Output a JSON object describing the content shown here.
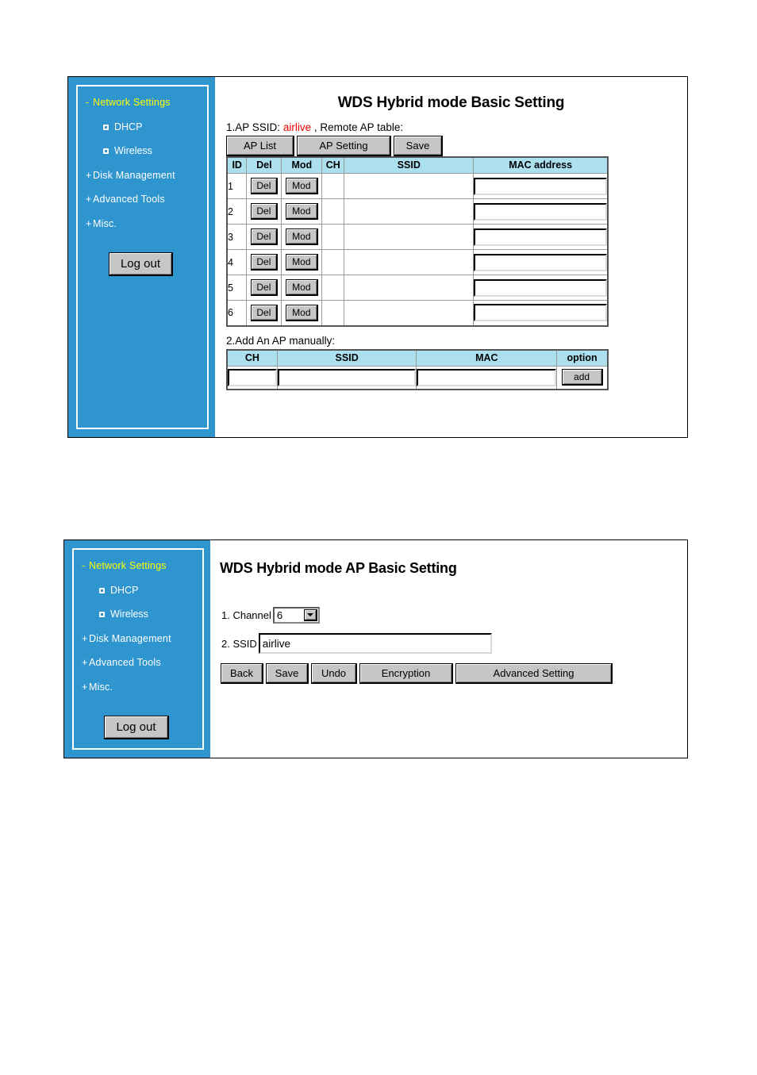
{
  "sidebar": {
    "items": [
      {
        "sign": "-",
        "label": "Network Settings",
        "state": "expanded"
      },
      {
        "sign": "+",
        "label": "Disk Management",
        "state": "collapsed"
      },
      {
        "sign": "+",
        "label": "Advanced Tools",
        "state": "collapsed"
      },
      {
        "sign": "+",
        "label": "Misc.",
        "state": "collapsed"
      }
    ],
    "subitems": [
      {
        "label": "DHCP"
      },
      {
        "label": "Wireless"
      }
    ],
    "logout_label": "Log out",
    "accent_color": "#ffff00",
    "background_color": "#2f95cf",
    "text_color": "#ffffff"
  },
  "panel1": {
    "title": "WDS Hybrid mode Basic Setting",
    "ap_ssid_prefix": "1.AP SSID:",
    "ap_ssid_value": "airlive",
    "ap_ssid_suffix": ", Remote AP table:",
    "buttons": {
      "ap_list": "AP List",
      "ap_setting": "AP Setting",
      "save": "Save"
    },
    "remote_table": {
      "headers": [
        "ID",
        "Del",
        "Mod",
        "CH",
        "SSID",
        "MAC address"
      ],
      "header_color": "#ace0ef",
      "rows": [
        {
          "id": "1",
          "del": "Del",
          "mod": "Mod",
          "ch": "",
          "ssid": "",
          "mac": ""
        },
        {
          "id": "2",
          "del": "Del",
          "mod": "Mod",
          "ch": "",
          "ssid": "",
          "mac": ""
        },
        {
          "id": "3",
          "del": "Del",
          "mod": "Mod",
          "ch": "",
          "ssid": "",
          "mac": ""
        },
        {
          "id": "4",
          "del": "Del",
          "mod": "Mod",
          "ch": "",
          "ssid": "",
          "mac": ""
        },
        {
          "id": "5",
          "del": "Del",
          "mod": "Mod",
          "ch": "",
          "ssid": "",
          "mac": ""
        },
        {
          "id": "6",
          "del": "Del",
          "mod": "Mod",
          "ch": "",
          "ssid": "",
          "mac": ""
        }
      ]
    },
    "add_ap_label": "2.Add An AP manually:",
    "add_table": {
      "headers": [
        "CH",
        "SSID",
        "MAC",
        "option"
      ],
      "row": {
        "ch": "",
        "ssid": "",
        "mac": "",
        "add_label": "add"
      }
    }
  },
  "panel2": {
    "title": "WDS Hybrid mode AP Basic Setting",
    "channel_label": "1. Channel",
    "channel_value": "6",
    "ssid_label": "2. SSID",
    "ssid_value": "airlive",
    "buttons": {
      "back": "Back",
      "save": "Save",
      "undo": "Undo",
      "encryption": "Encryption",
      "advanced": "Advanced Setting"
    }
  }
}
